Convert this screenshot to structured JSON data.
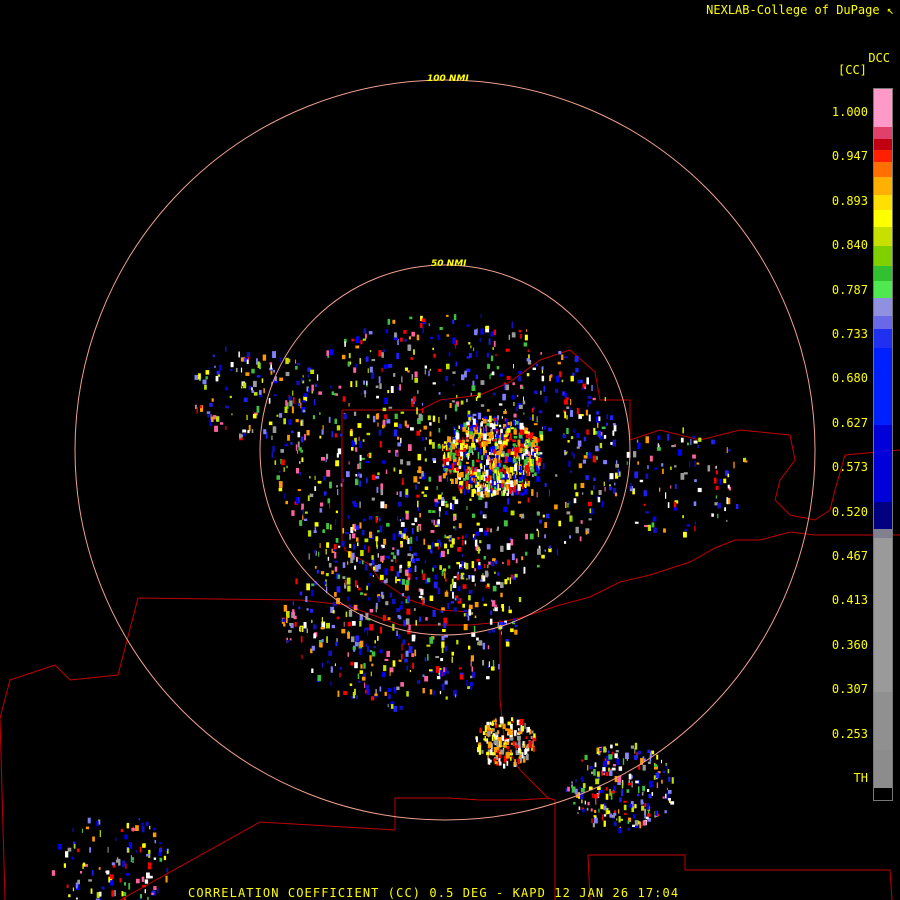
{
  "attribution": "NEXLAB-College of DuPage",
  "attribution_icon": "cursor-arrow-icon",
  "product_title": "CORRELATION COEFFICIENT (CC) 0.5 DEG - KAPD 12 JAN 26 17:04",
  "legend": {
    "product_code": "DCC",
    "unit": "[CC]",
    "ticks": [
      "1.000",
      "0.947",
      "0.893",
      "0.840",
      "0.787",
      "0.733",
      "0.680",
      "0.627",
      "0.573",
      "0.520",
      "0.467",
      "0.413",
      "0.360",
      "0.307",
      "0.253",
      "TH"
    ]
  },
  "range_rings": [
    {
      "label": "100 NMI"
    },
    {
      "label": "50 NMI"
    }
  ],
  "colors": {
    "ring": "#f0a090",
    "boundary": "#c00000",
    "text": "#ffff00",
    "scale": [
      "#ff9ac8",
      "#e0406a",
      "#c00010",
      "#ff2000",
      "#ff7000",
      "#ffb000",
      "#ffe000",
      "#ffff00",
      "#c8e000",
      "#80d000",
      "#30c030",
      "#50e850",
      "#9090e0",
      "#6868e8",
      "#2030f0",
      "#0020ff",
      "#0000d8",
      "#000080",
      "#808090",
      "#9a9a9a",
      "#909090",
      "#8c8c8c",
      "#000000"
    ]
  }
}
